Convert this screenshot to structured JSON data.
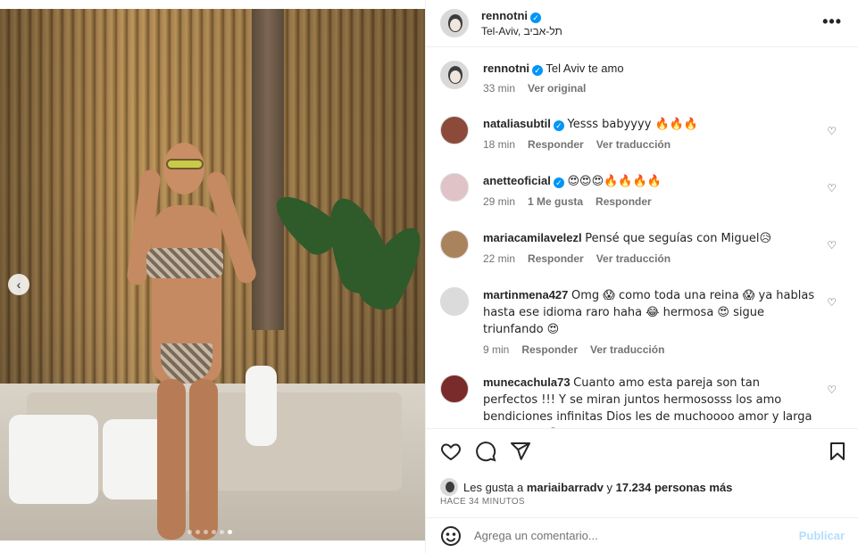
{
  "post": {
    "username": "rennotni",
    "location": "Tel-Aviv, תל-אביב",
    "menu_icon": "more-horizontal-icon"
  },
  "caption": {
    "username": "rennotni",
    "text": "Tel Aviv te amo",
    "time": "33 min",
    "action": "Ver original"
  },
  "comments": [
    {
      "username": "nataliasubtil",
      "verified": true,
      "text": "Yesss babyyyy 🔥🔥🔥",
      "time": "18 min",
      "a1": "Responder",
      "a2": "Ver traducción",
      "avatar_color": "#8b4a3a"
    },
    {
      "username": "anetteoficial",
      "verified": true,
      "text": "😍😍😍🔥🔥🔥🔥",
      "time": "29 min",
      "a1": "1 Me gusta",
      "a2": "Responder",
      "avatar_color": "#e0c3c6"
    },
    {
      "username": "mariacamilavelezl",
      "verified": false,
      "text": "Pensé que seguías con Miguel😥",
      "time": "22 min",
      "a1": "Responder",
      "a2": "Ver traducción",
      "avatar_color": "#a8835c"
    },
    {
      "username": "martinmena427",
      "verified": false,
      "text": "Omg 😱 como toda una reina 😱 ya hablas hasta ese idioma raro haha 😂 hermosa 😍 sigue triunfando 😍",
      "time": "9 min",
      "a1": "Responder",
      "a2": "Ver traducción",
      "avatar_color": "#dbdbdb"
    },
    {
      "username": "munecachula73",
      "verified": false,
      "text": "Cuanto amo esta pareja son tan perfectos !!! Y se miran juntos hermososss los amo bendiciones infinitas Dios les de muchoooo amor y larga vida juntos😍",
      "time": "",
      "a1": "",
      "a2": "",
      "avatar_color": "#7a2a2a"
    }
  ],
  "likes": {
    "prefix": "Les gusta a ",
    "user": "mariaibarradv",
    "mid": " y ",
    "count": "17.234 personas más"
  },
  "timestamp": "HACE 34 MINUTOS",
  "add_comment": {
    "placeholder": "Agrega un comentario...",
    "publish": "Publicar"
  },
  "carousel": {
    "total": 6,
    "active_index": 5
  }
}
